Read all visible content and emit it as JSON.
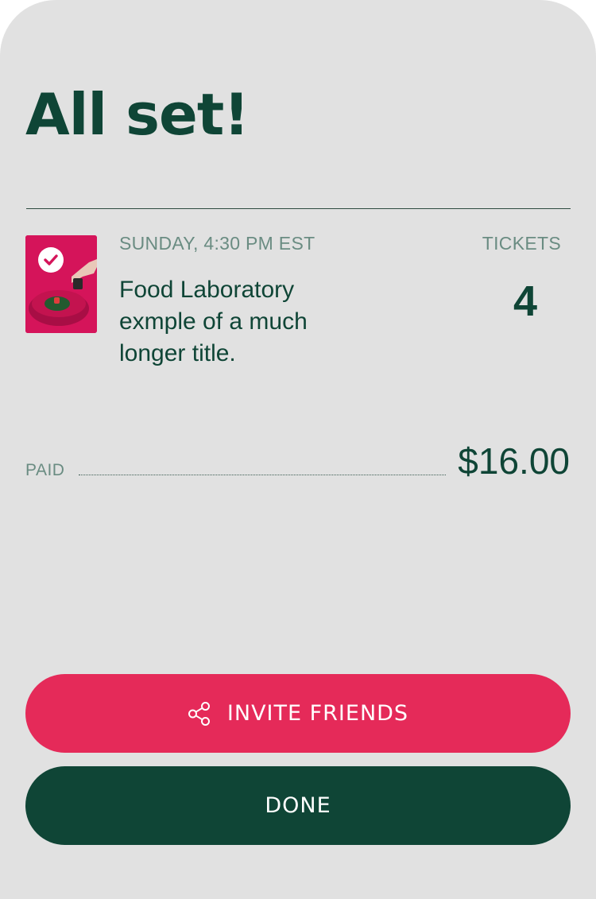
{
  "header": {
    "title": "All set!"
  },
  "event": {
    "date": "SUNDAY, 4:30 PM EST",
    "title": "Food Laboratory exmple of a much longer title.",
    "tickets_label": "TICKETS",
    "tickets_count": "4",
    "thumbnail_icon": "check-icon"
  },
  "payment": {
    "label": "PAID",
    "amount": "$16.00"
  },
  "actions": {
    "invite_label": "INVITE FRIENDS",
    "invite_icon": "share-icon",
    "done_label": "DONE"
  },
  "colors": {
    "background": "#e1e1e1",
    "primary_text": "#0f4536",
    "secondary_text": "#6a8c82",
    "accent": "#e52a59",
    "done_button": "#0f4536"
  }
}
